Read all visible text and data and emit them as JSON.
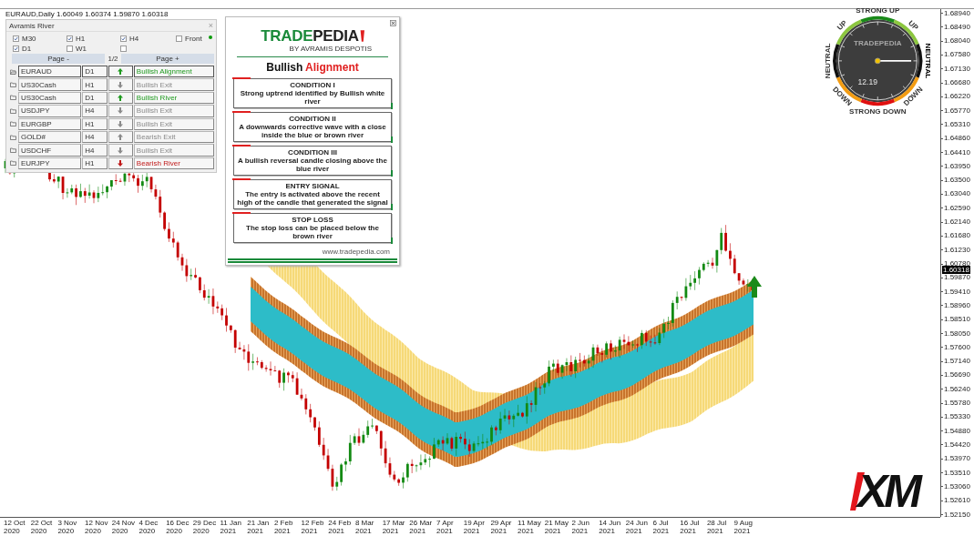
{
  "chart": {
    "symbol_line": "EURAUD,Daily  1.60049 1.60374 1.59870 1.60318",
    "price_labels": [
      "1.68940",
      "1.68490",
      "1.68040",
      "1.67580",
      "1.67130",
      "1.66680",
      "1.66220",
      "1.65770",
      "1.65310",
      "1.64860",
      "1.64410",
      "1.63950",
      "1.63500",
      "1.63040",
      "1.62590",
      "1.62140",
      "1.61680",
      "1.61230",
      "1.60780",
      "1.59870",
      "1.59410",
      "1.58960",
      "1.58510",
      "1.58050",
      "1.57600",
      "1.57140",
      "1.56690",
      "1.56240",
      "1.55780",
      "1.55330",
      "1.54880",
      "1.54420",
      "1.53970",
      "1.53510",
      "1.53060",
      "1.52610",
      "1.52150"
    ],
    "current_price": "1.60318",
    "time_labels": [
      "12 Oct 2020",
      "22 Oct 2020",
      "3 Nov 2020",
      "12 Nov 2020",
      "24 Nov 2020",
      "4 Dec 2020",
      "16 Dec 2020",
      "29 Dec 2020",
      "11 Jan 2021",
      "21 Jan 2021",
      "2 Feb 2021",
      "12 Feb 2021",
      "24 Feb 2021",
      "8 Mar 2021",
      "17 Mar 2021",
      "26 Mar 2021",
      "7 Apr 2021",
      "19 Apr 2021",
      "29 Apr 2021",
      "11 May 2021",
      "21 May 2021",
      "2 Jun 2021",
      "14 Jun 2021",
      "24 Jun 2021",
      "6 Jul 2021",
      "16 Jul 2021",
      "28 Jul 2021",
      "9 Aug 2021"
    ],
    "signal_arrow": {
      "kind": "up"
    }
  },
  "panel": {
    "title": "Avramis River",
    "close": "×",
    "status_active": true,
    "checkboxes": [
      {
        "label": "M30",
        "checked": true
      },
      {
        "label": "H1",
        "checked": true
      },
      {
        "label": "H4",
        "checked": true
      },
      {
        "label": "Front",
        "checked": false
      },
      {
        "label": "D1",
        "checked": true
      },
      {
        "label": "W1",
        "checked": false
      },
      {
        "checked": false
      }
    ],
    "page_prev": "Page -",
    "page_indicator": "1/2",
    "page_next": "Page +",
    "rows": [
      {
        "symbol": "EURAUD",
        "timeframe": "D1",
        "kind": "up",
        "signal": "Bullish Alignment",
        "color": "#1e9a1e",
        "selected": true
      },
      {
        "symbol": "US30Cash",
        "timeframe": "H1",
        "kind": "down",
        "signal": "Bullish Exit",
        "color": "#8a8a8a",
        "selected": false
      },
      {
        "symbol": "US30Cash",
        "timeframe": "D1",
        "kind": "up",
        "signal": "Bullish River",
        "color": "#1e9a1e",
        "selected": false
      },
      {
        "symbol": "USDJPY",
        "timeframe": "H4",
        "kind": "down",
        "signal": "Bullish Exit",
        "color": "#8a8a8a",
        "selected": false
      },
      {
        "symbol": "EURGBP",
        "timeframe": "H1",
        "kind": "down",
        "signal": "Bullish Exit",
        "color": "#8a8a8a",
        "selected": false
      },
      {
        "symbol": "GOLD#",
        "timeframe": "H4",
        "kind": "up",
        "signal": "Bearish Exit",
        "color": "#8a8a8a",
        "selected": false
      },
      {
        "symbol": "USDCHF",
        "timeframe": "H4",
        "kind": "down",
        "signal": "Bullish Exit",
        "color": "#8a8a8a",
        "selected": false
      },
      {
        "symbol": "EURJPY",
        "timeframe": "H1",
        "kind": "down",
        "signal": "Bearish River",
        "color": "#c01818",
        "selected": false
      }
    ]
  },
  "card": {
    "logo_first": "TRADE",
    "logo_second": "PEDIA",
    "byline": "BY AVRAMIS DESPOTIS",
    "title": "Bullish",
    "title_highlight": "Alignment",
    "conditions": [
      {
        "heading": "CONDITION I",
        "text": "Strong uptrend identified by Bullish white river"
      },
      {
        "heading": "CONDITION II",
        "text": "A downwards corrective wave with a close inside the blue or brown river"
      },
      {
        "heading": "CONDITION III",
        "text": "A bullish reversal candle closing above the blue river"
      },
      {
        "heading": "ENTRY SIGNAL",
        "text": "The entry is activated above the recent high of the candle that generated the signal"
      },
      {
        "heading": "STOP LOSS",
        "text": "The stop loss can be placed below the brown river"
      }
    ],
    "footer": "www.tradepedia.com"
  },
  "gauge": {
    "brand": "TRADEPEDIA",
    "value": "12.19",
    "labels": [
      {
        "text": "STRONG UP",
        "color": "#1a8a1a",
        "selected": false
      },
      {
        "text": "UP",
        "color": "#8cc63f",
        "selected": false
      },
      {
        "text": "NEUTRAL",
        "color": "#111111",
        "selected": true
      },
      {
        "text": "DOWN",
        "color": "#f39c12",
        "selected": false
      },
      {
        "text": "STRONG DOWN",
        "color": "#e01010",
        "selected": false
      },
      {
        "text": "DOWN",
        "color": "#f39c12",
        "selected": false
      },
      {
        "text": "NEUTRAL",
        "color": "#111111",
        "selected": false
      },
      {
        "text": "UP",
        "color": "#8cc63f",
        "selected": false
      }
    ]
  },
  "logo": {
    "text": "XM"
  }
}
